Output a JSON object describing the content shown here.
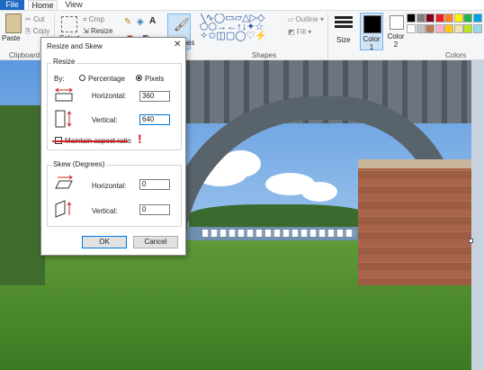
{
  "ribbon": {
    "tabs": [
      "File",
      "Home",
      "View"
    ],
    "clipboard": {
      "paste": "Paste",
      "cut": "Cut",
      "copy": "Copy",
      "group": "Clipboard"
    },
    "image": {
      "select": "Select",
      "crop": "Crop",
      "resize": "Resize"
    },
    "brushes": "Brushes",
    "shapes": {
      "outline": "Outline",
      "fill": "Fill",
      "group": "Shapes"
    },
    "size": "Size",
    "color1": "Color\n1",
    "color2": "Color\n2",
    "colors_group": "Colors",
    "palette_row1": [
      "#000000",
      "#7f7f7f",
      "#880015",
      "#ed1c24",
      "#ff7f27",
      "#fff200",
      "#22b14c",
      "#00a2e8"
    ],
    "palette_row2": [
      "#ffffff",
      "#c3c3c3",
      "#b97a57",
      "#ffaec9",
      "#ffc90e",
      "#efe4b0",
      "#b5e61d",
      "#99d9ea"
    ]
  },
  "dialog": {
    "title": "Resize and Skew",
    "close": "✕",
    "resize_legend": "Resize",
    "by_label": "By:",
    "percentage_label": "Percentage",
    "pixels_label": "Pixels",
    "horizontal_label": "Horizontal:",
    "horizontal_value": "360",
    "vertical_label": "Vertical:",
    "vertical_value": "640",
    "maintain_label": "Maintain aspect ratio",
    "maintain_checked": false,
    "skew_legend": "Skew (Degrees)",
    "skew_horizontal_label": "Horizontal:",
    "skew_horizontal_value": "0",
    "skew_vertical_label": "Vertical:",
    "skew_vertical_value": "0",
    "ok": "OK",
    "cancel": "Cancel",
    "annotation_mark": "!"
  }
}
